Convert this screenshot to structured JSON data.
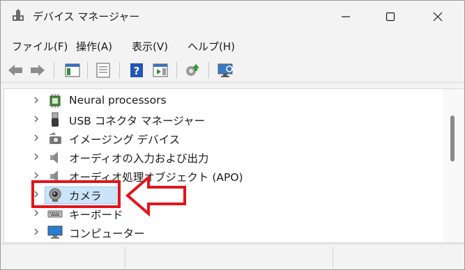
{
  "window": {
    "title": "デバイス マネージャー"
  },
  "menu": [
    {
      "label": "ファイル(F)"
    },
    {
      "label": "操作(A)"
    },
    {
      "label": "表示(V)"
    },
    {
      "label": "ヘルプ(H)"
    }
  ],
  "toolbar": {
    "icons": [
      "back-icon",
      "forward-icon",
      "show-hide-console-tree-icon",
      "properties-icon",
      "help-icon",
      "action-pane-icon",
      "update-driver-icon",
      "scan-hardware-icon"
    ]
  },
  "tree": {
    "items": [
      {
        "label": "Neural processors",
        "icon": "chip-icon"
      },
      {
        "label": "USB コネクタ マネージャー",
        "icon": "usb-connector-icon"
      },
      {
        "label": "イメージング デバイス",
        "icon": "imaging-device-icon"
      },
      {
        "label": "オーディオの入力および出力",
        "icon": "speaker-icon"
      },
      {
        "label": "オーディオ処理オブジェクト (APO)",
        "icon": "speaker-icon"
      },
      {
        "label": "カメラ",
        "icon": "camera-icon",
        "selected": true
      },
      {
        "label": "キーボード",
        "icon": "keyboard-icon"
      },
      {
        "label": "コンピューター",
        "icon": "monitor-icon"
      }
    ]
  },
  "annotation": {
    "highlight_color": "#e4141c"
  },
  "colors": {
    "selection_bg": "#cce4f7",
    "selection_border": "#99c9ef"
  }
}
